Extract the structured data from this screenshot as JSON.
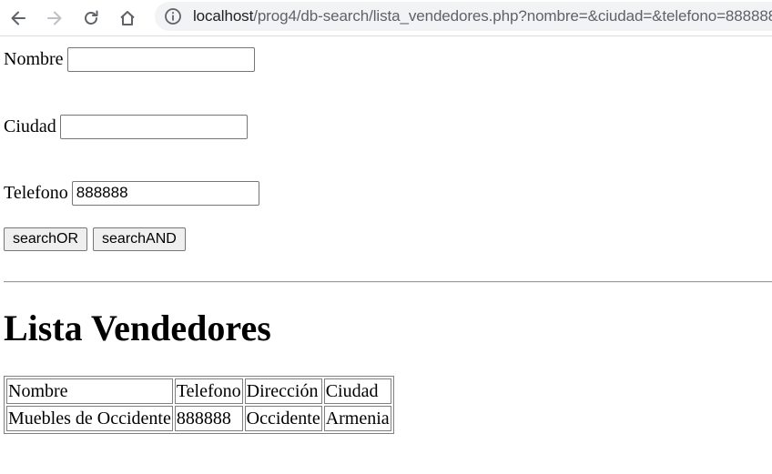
{
  "browser": {
    "url_host": "localhost",
    "url_path": "/prog4/db-search/lista_vendedores.php?nombre=&ciudad=&telefono=888888"
  },
  "form": {
    "nombre_label": "Nombre",
    "nombre_value": "",
    "ciudad_label": "Ciudad",
    "ciudad_value": "",
    "telefono_label": "Telefono",
    "telefono_value": "888888",
    "search_or_label": "searchOR",
    "search_and_label": "searchAND"
  },
  "heading": "Lista Vendedores",
  "table": {
    "headers": [
      "Nombre",
      "Telefono",
      "Dirección",
      "Ciudad"
    ],
    "rows": [
      [
        "Muebles de Occidente",
        "888888",
        "Occidente",
        "Armenia"
      ]
    ]
  },
  "icons": [
    "back-arrow-icon",
    "forward-arrow-icon",
    "reload-icon",
    "home-icon",
    "info-icon"
  ]
}
